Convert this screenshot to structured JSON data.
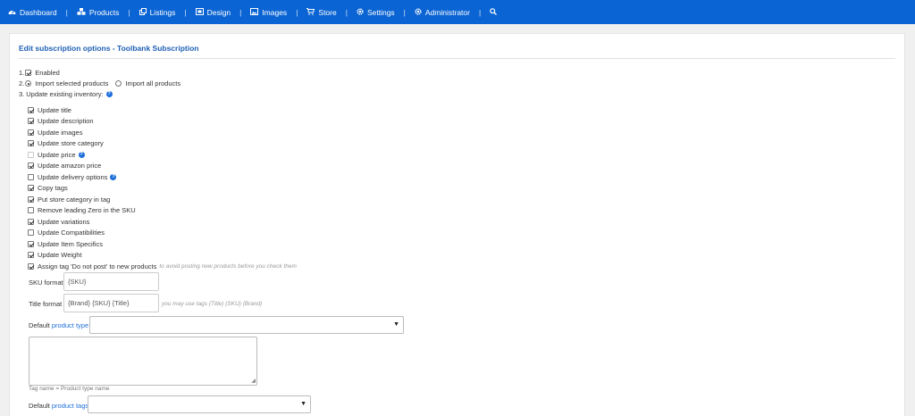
{
  "nav": {
    "items": [
      {
        "label": "Dashboard",
        "icon": "dashboard-icon"
      },
      {
        "label": "Products",
        "icon": "cubes-icon"
      },
      {
        "label": "Listings",
        "icon": "clone-icon"
      },
      {
        "label": "Design",
        "icon": "design-icon"
      },
      {
        "label": "Images",
        "icon": "image-icon"
      },
      {
        "label": "Store",
        "icon": "cart-icon"
      },
      {
        "label": "Settings",
        "icon": "gear-icon"
      },
      {
        "label": "Administrator",
        "icon": "admin-gear-icon"
      }
    ],
    "separator": "|",
    "search_icon": "search-icon"
  },
  "panel": {
    "title": "Edit subscription options - Toolbank Subscription"
  },
  "steps": {
    "s1_num": "1.",
    "s1_label": "Enabled",
    "s2_num": "2.",
    "s2_opt1": "Import selected products",
    "s2_opt2": "Import all products",
    "s3_num": "3.",
    "s3_label": "Update existing inventory:"
  },
  "options": [
    {
      "label": "Update title",
      "checked": true
    },
    {
      "label": "Update description",
      "checked": true
    },
    {
      "label": "Update images",
      "checked": true
    },
    {
      "label": "Update store category",
      "checked": true
    },
    {
      "label": "Update price",
      "checked": false,
      "help": true
    },
    {
      "label": "Update amazon price",
      "checked": true
    },
    {
      "label": "Update delivery options",
      "checked": false,
      "help": true
    },
    {
      "label": "Copy tags",
      "checked": true
    },
    {
      "label": "Put store category in tag",
      "checked": true
    },
    {
      "label": "Remove leading Zero in the SKU",
      "checked": false
    },
    {
      "label": "Update variations",
      "checked": true
    },
    {
      "label": "Update Compatibilities",
      "checked": false
    },
    {
      "label": "Update Item Specifics",
      "checked": true
    },
    {
      "label": "Update Weight",
      "checked": true
    },
    {
      "label": "Assign tag 'Do not post' to new products",
      "checked": true,
      "hint": "to avoid posting new products before you check them"
    }
  ],
  "form": {
    "sku_label": "SKU format",
    "sku_value": "{SKU}",
    "title_label": "Title format",
    "title_value": "{Brand} {SKU} {Title}",
    "title_hint": "you may use tags {Title} {SKU} {Brand}",
    "product_type_prefix": "Default",
    "product_type_link": "product type",
    "product_type_value": "",
    "tag_note": "Tag name = Product type name",
    "product_tags_prefix": "Default",
    "product_tags_link": "product tags",
    "product_tags_value": "",
    "dropdown_arrow": "▼",
    "help_glyph": "?"
  }
}
